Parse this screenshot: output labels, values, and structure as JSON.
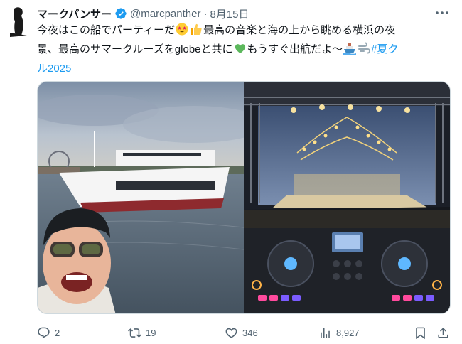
{
  "author": {
    "name": "マークパンサー",
    "handle": "@marcpanther",
    "separator": "·",
    "date": "8月15日"
  },
  "tweet": {
    "line1_a": "今夜はこの船でパーティーだ",
    "line1_b": "最高の音楽と海の上から眺める横浜の夜",
    "line2_a": "景、最高のサマークルーズをglobeと共に",
    "line2_b": "もうすぐ出航だよ〜",
    "hashtag_part1": "#夏ク",
    "hashtag_part2": "ル2025",
    "emojis": [
      "star-struck-emoji",
      "thumbs-up-emoji",
      "green-heart-emoji",
      "ship-emoji",
      "dash-emoji"
    ]
  },
  "media": {
    "photos": [
      {
        "subject": "cruise-ship-selfie"
      },
      {
        "subject": "dj-deck-stage"
      }
    ]
  },
  "actions": {
    "replies": "2",
    "reposts": "19",
    "likes": "346",
    "views": "8,927"
  },
  "colors": {
    "text": "#0f1419",
    "secondary": "#536471",
    "link": "#1d9bf0",
    "verified": "#1d9bf0"
  }
}
